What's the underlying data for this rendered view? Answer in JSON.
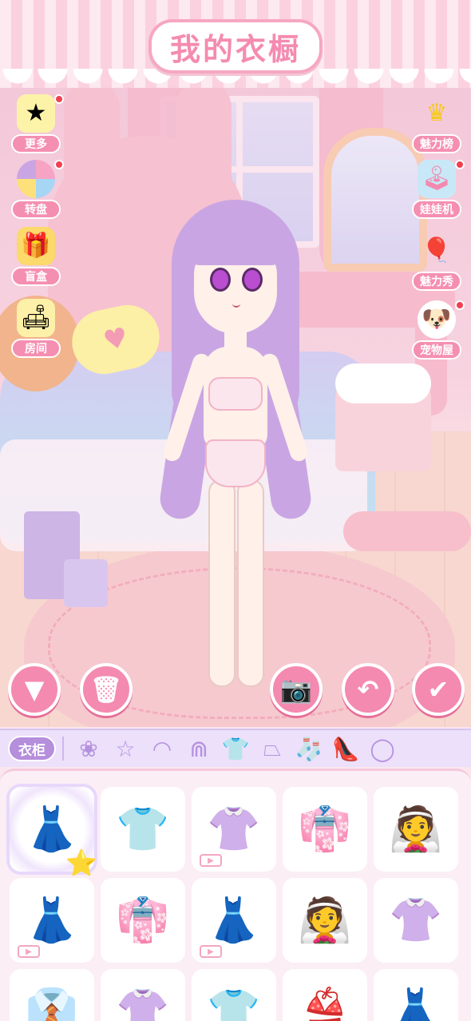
{
  "header": {
    "title": "我的衣橱"
  },
  "left_menu": [
    {
      "label": "更多",
      "icon": "notebook-star-icon",
      "dot": true
    },
    {
      "label": "转盘",
      "icon": "roulette-wheel-icon",
      "dot": true
    },
    {
      "label": "盲盒",
      "icon": "gift-box-icon",
      "dot": false
    },
    {
      "label": "房间",
      "icon": "sofa-lamp-icon",
      "dot": false
    }
  ],
  "right_menu": [
    {
      "label": "魅力榜",
      "icon": "crown-icon",
      "dot": false
    },
    {
      "label": "娃娃机",
      "icon": "claw-machine-icon",
      "dot": true
    },
    {
      "label": "魅力秀",
      "icon": "balloons-icon",
      "dot": false
    },
    {
      "label": "宠物屋",
      "icon": "puppy-icon",
      "dot": true
    }
  ],
  "actions": {
    "hide": "▼",
    "delete": "🗑",
    "camera": "📷",
    "undo": "↶",
    "confirm": "✔"
  },
  "category_bar": {
    "wardrobe_label": "衣柜",
    "categories": [
      {
        "name": "paw",
        "glyph": "❀"
      },
      {
        "name": "star",
        "glyph": "☆"
      },
      {
        "name": "hair-short",
        "glyph": "◠"
      },
      {
        "name": "hair-long",
        "glyph": "⋒"
      },
      {
        "name": "top",
        "glyph": "👕",
        "active": true
      },
      {
        "name": "skirt",
        "glyph": "⏢"
      },
      {
        "name": "socks",
        "glyph": "🧦"
      },
      {
        "name": "shoes",
        "glyph": "👠"
      },
      {
        "name": "more",
        "glyph": "◯"
      }
    ]
  },
  "items": [
    {
      "glyph": "👗",
      "selected": true,
      "video": false
    },
    {
      "glyph": "👕",
      "selected": false,
      "video": false
    },
    {
      "glyph": "👚",
      "selected": false,
      "video": true
    },
    {
      "glyph": "👘",
      "selected": false,
      "video": false
    },
    {
      "glyph": "👰",
      "selected": false,
      "video": false
    },
    {
      "glyph": "👗",
      "selected": false,
      "video": true
    },
    {
      "glyph": "👘",
      "selected": false,
      "video": false
    },
    {
      "glyph": "👗",
      "selected": false,
      "video": true
    },
    {
      "glyph": "👰",
      "selected": false,
      "video": false
    },
    {
      "glyph": "👚",
      "selected": false,
      "video": false
    },
    {
      "glyph": "👔",
      "selected": false,
      "video": false
    },
    {
      "glyph": "👚",
      "selected": false,
      "video": false
    },
    {
      "glyph": "👕",
      "selected": false,
      "video": false
    },
    {
      "glyph": "👙",
      "selected": false,
      "video": false
    },
    {
      "glyph": "👗",
      "selected": false,
      "video": false
    }
  ],
  "colors": {
    "accent_pink": "#f48ab0",
    "lavender": "#b58edc",
    "active_category": "#f5d733"
  }
}
